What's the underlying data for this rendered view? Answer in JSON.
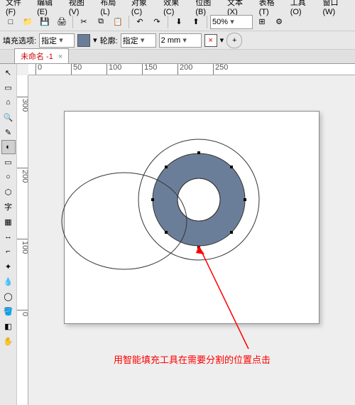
{
  "menu": {
    "file": "文件(F)",
    "edit": "编辑(E)",
    "view": "视图(V)",
    "layout": "布局(L)",
    "object": "对象(C)",
    "effects": "效果(C)",
    "bitmap": "位图(B)",
    "text": "文本(X)",
    "table": "表格(T)",
    "tools": "工具(O)",
    "window": "窗口(W)"
  },
  "toolbar": {
    "zoom": "50%"
  },
  "propbar": {
    "fill_label": "填充选项:",
    "fill_mode": "指定",
    "outline_label": "轮廓:",
    "outline_mode": "指定",
    "stroke_width": "2 mm",
    "fill_color": "#6b7e99",
    "no_outline": "×"
  },
  "tab": {
    "name": "未命名 -1",
    "close": "×"
  },
  "ruler_h": [
    {
      "pos": 10,
      "label": "0"
    },
    {
      "pos": 60,
      "label": "50"
    },
    {
      "pos": 110,
      "label": "100"
    },
    {
      "pos": 160,
      "label": "150"
    },
    {
      "pos": 210,
      "label": "200"
    },
    {
      "pos": 260,
      "label": "250"
    }
  ],
  "ruler_v": [
    {
      "pos": 30,
      "label": "300"
    },
    {
      "pos": 130,
      "label": "200"
    },
    {
      "pos": 230,
      "label": "100"
    },
    {
      "pos": 330,
      "label": "0"
    }
  ],
  "annotation": "用智能填充工具在需要分割的位置点击",
  "icons": {
    "new": "□",
    "open": "📁",
    "save": "💾",
    "print": "🖨",
    "cut": "✂",
    "copy": "⧉",
    "paste": "📋",
    "undo": "↶",
    "redo": "↷",
    "import": "⬇",
    "export": "⬆",
    "zoom_in": "🔍",
    "options": "⚙",
    "add": "+",
    "pick": "↖",
    "shape": "▭",
    "freehand": "✎",
    "pen": "✒",
    "smart": "◐",
    "rect": "▭",
    "ellipse": "○",
    "poly": "⬡",
    "text": "字",
    "table": "▦",
    "dim": "↔",
    "conn": "⌐",
    "fx": "✦",
    "drop": "💧",
    "fill": "🪣",
    "blend": "◧",
    "pan": "✋",
    "zoom": "🔍"
  }
}
